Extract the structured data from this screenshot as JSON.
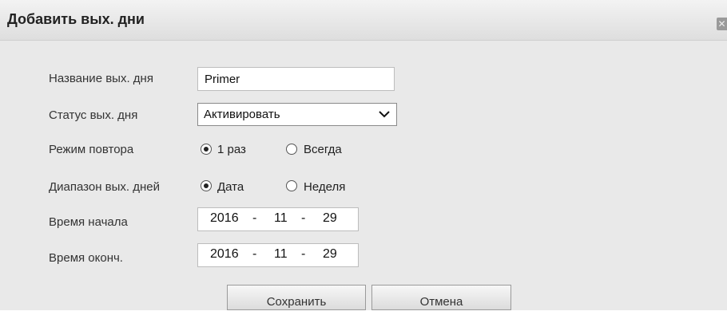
{
  "dialog": {
    "title": "Добавить вых. дни",
    "close_glyph": "✕"
  },
  "form": {
    "name": {
      "label": "Название вых. дня",
      "value": "Primer"
    },
    "status": {
      "label": "Статус вых. дня",
      "value": "Активировать"
    },
    "repeat": {
      "label": "Режим повтора",
      "options": [
        {
          "label": "1 раз",
          "checked": true
        },
        {
          "label": "Всегда",
          "checked": false
        }
      ]
    },
    "range": {
      "label": "Диапазон вых. дней",
      "options": [
        {
          "label": "Дата",
          "checked": true
        },
        {
          "label": "Неделя",
          "checked": false
        }
      ]
    },
    "start": {
      "label": "Время начала",
      "year": "2016",
      "month": "11",
      "day": "29"
    },
    "end": {
      "label": "Время оконч.",
      "year": "2016",
      "month": "11",
      "day": "29"
    },
    "date_separator": "-"
  },
  "buttons": {
    "save": "Сохранить",
    "cancel": "Отмена"
  }
}
